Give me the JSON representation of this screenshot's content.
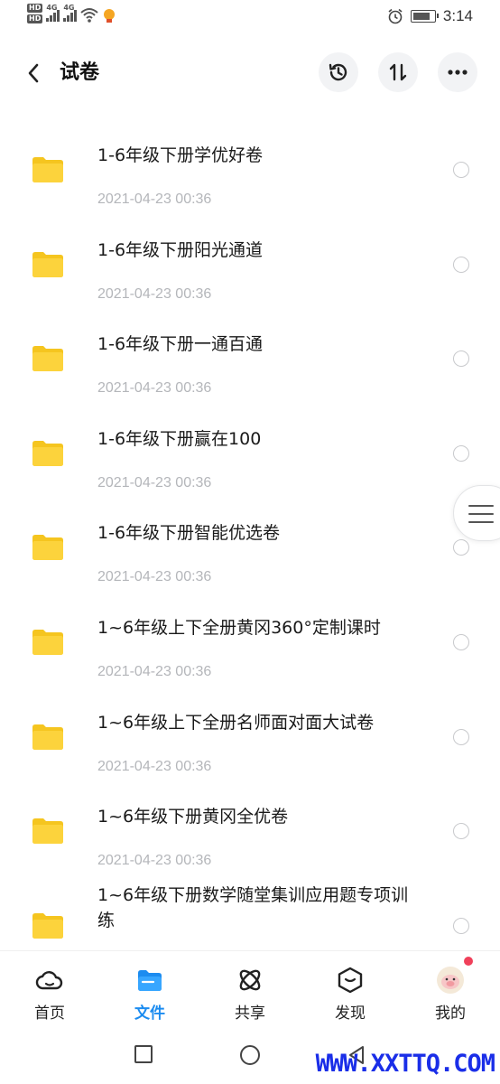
{
  "status_bar": {
    "hd1": "HD",
    "hd2": "HD",
    "net1": "4G",
    "net2": "4G",
    "time": "3:14",
    "battery_level": 0.85
  },
  "header": {
    "title": "试卷"
  },
  "files": [
    {
      "name": "1-6年级下册学优好卷",
      "date": "2021-04-23  00:36"
    },
    {
      "name": "1-6年级下册阳光通道",
      "date": "2021-04-23  00:36"
    },
    {
      "name": "1-6年级下册一通百通",
      "date": "2021-04-23  00:36"
    },
    {
      "name": "1-6年级下册赢在100",
      "date": "2021-04-23  00:36"
    },
    {
      "name": "1-6年级下册智能优选卷",
      "date": "2021-04-23  00:36"
    },
    {
      "name": "1~6年级上下全册黄冈360°定制课时",
      "date": "2021-04-23  00:36"
    },
    {
      "name": "1~6年级上下全册名师面对面大试卷",
      "date": "2021-04-23  00:36"
    },
    {
      "name": "1~6年级下册黄冈全优卷",
      "date": "2021-04-23  00:36"
    },
    {
      "name": "1~6年级下册数学随堂集训应用题专项训练",
      "date": ""
    }
  ],
  "bottom_nav": {
    "items": [
      {
        "label": "首页",
        "icon": "cloud-home-icon"
      },
      {
        "label": "文件",
        "icon": "folder-icon"
      },
      {
        "label": "共享",
        "icon": "atom-share-icon"
      },
      {
        "label": "发现",
        "icon": "discover-box-icon"
      },
      {
        "label": "我的",
        "icon": "avatar-icon"
      }
    ],
    "active_index": 1
  },
  "watermark": "WWW.XXTTQ.COM",
  "colors": {
    "accent": "#1c8cf0",
    "folder": "#fcd33c",
    "meta_text": "#b4b6ba",
    "badge": "#f0405a"
  }
}
